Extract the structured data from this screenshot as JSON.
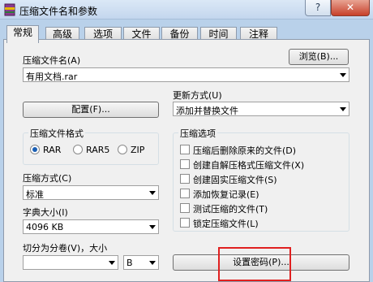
{
  "window": {
    "title": "压缩文件名和参数",
    "help_label": "?",
    "close_label": "✕"
  },
  "tabs": [
    "常规",
    "高级",
    "选项",
    "文件",
    "备份",
    "时间",
    "注释"
  ],
  "archive": {
    "name_label": "压缩文件名(A)",
    "browse_label": "浏览(B)...",
    "name_value": "有用文档.rar"
  },
  "update": {
    "label": "更新方式(U)",
    "value": "添加并替换文件"
  },
  "profile_button": "配置(F)...",
  "format": {
    "caption": "压缩文件格式",
    "options": [
      "RAR",
      "RAR5",
      "ZIP"
    ],
    "selected": "RAR"
  },
  "compress_options": {
    "caption": "压缩选项",
    "items": [
      "压缩后删除原来的文件(D)",
      "创建自解压格式压缩文件(X)",
      "创建固实压缩文件(S)",
      "添加恢复记录(E)",
      "测试压缩的文件(T)",
      "锁定压缩文件(L)"
    ]
  },
  "method": {
    "label": "压缩方式(C)",
    "value": "标准"
  },
  "dictionary": {
    "label": "字典大小(I)",
    "value": "4096 KB"
  },
  "split": {
    "label": "切分为分卷(V)，大小",
    "value": "",
    "unit": "B"
  },
  "password_button": "设置密码(P)..."
}
